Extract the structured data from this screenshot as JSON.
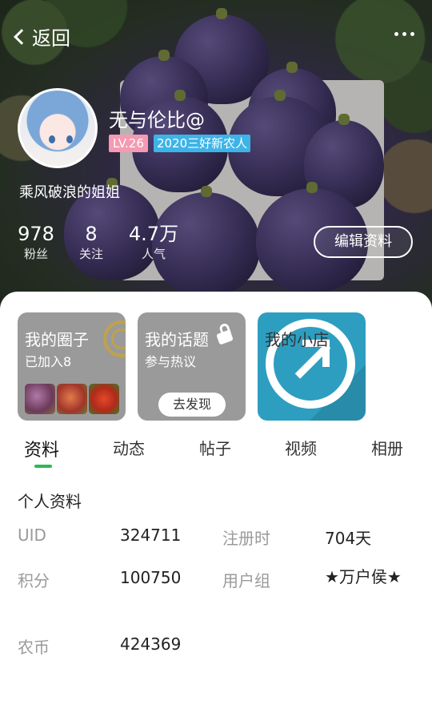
{
  "topbar": {
    "back_label": "返回"
  },
  "profile": {
    "username": "无与伦比@",
    "level": "LV.26",
    "title_badge": "2020三好新农人",
    "bio": "乘风破浪的姐姐",
    "stats": [
      {
        "value": "978",
        "label": "粉丝"
      },
      {
        "value": "8",
        "label": "关注"
      },
      {
        "value": "4.7万",
        "label": "人气"
      }
    ],
    "edit_label": "编辑资料"
  },
  "tiles": {
    "circles": {
      "title": "我的圈子",
      "subtitle": "已加入8"
    },
    "topics": {
      "title": "我的话题",
      "subtitle": "参与热议",
      "button": "去发现"
    },
    "shop": {
      "title": "我的小店"
    }
  },
  "tabs": [
    "资料",
    "动态",
    "帖子",
    "视频",
    "相册"
  ],
  "active_tab": "资料",
  "info": {
    "section_title": "个人资料",
    "uid_label": "UID",
    "uid_value": "324711",
    "reg_label": "注册时",
    "reg_value": "704天",
    "points_label": "积分",
    "points_value": "100750",
    "group_label": "用户组",
    "group_value": "★万户侯★",
    "coin_label": "农币",
    "coin_value": "424369"
  },
  "colors": {
    "accent": "#2db856",
    "level_badge": "#f59ab2",
    "title_badge": "#3db4e8",
    "shop_tile": "#2e9ec0"
  }
}
